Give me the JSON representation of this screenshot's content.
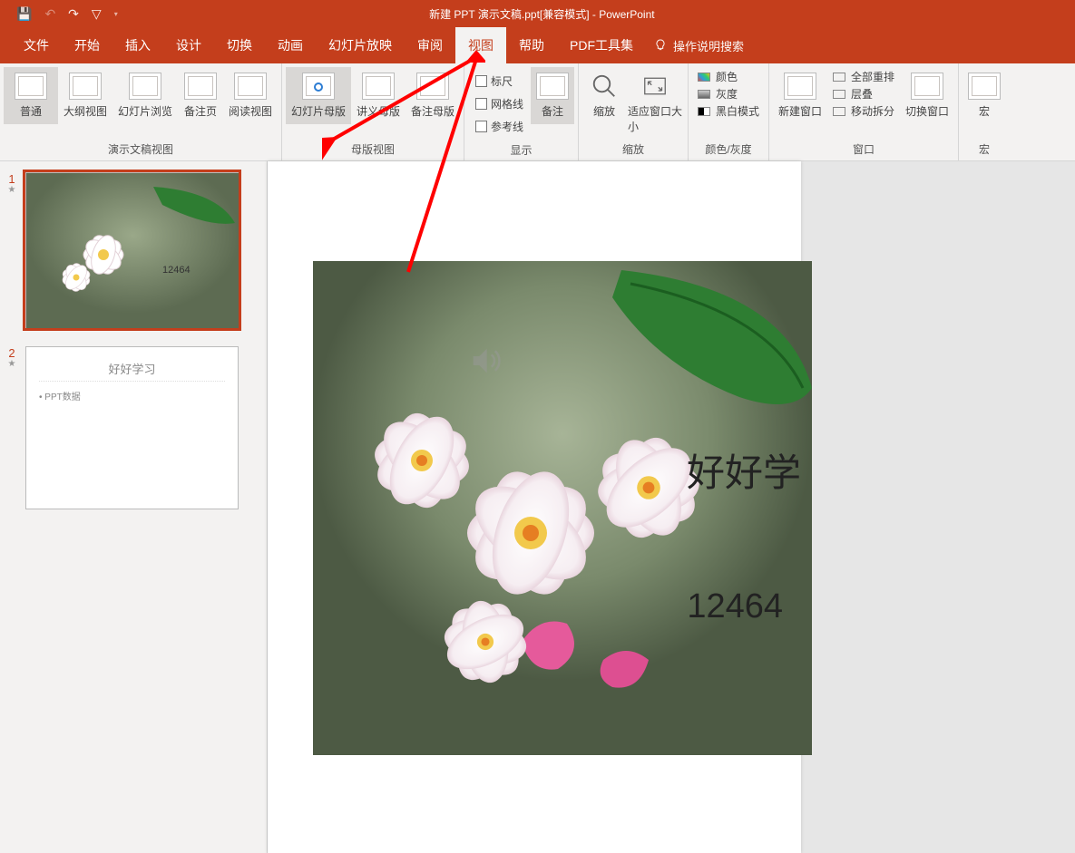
{
  "titlebar": {
    "title": "新建 PPT 演示文稿.ppt[兼容模式] - PowerPoint"
  },
  "menu": {
    "file": "文件",
    "home": "开始",
    "insert": "插入",
    "design": "设计",
    "transitions": "切换",
    "animations": "动画",
    "slideshow": "幻灯片放映",
    "review": "审阅",
    "view": "视图",
    "help": "帮助",
    "pdf": "PDF工具集",
    "tellme": "操作说明搜索"
  },
  "ribbon": {
    "normal": "普通",
    "outline": "大纲视图",
    "browse": "幻灯片浏览",
    "notes_page": "备注页",
    "reading": "阅读视图",
    "slide_master": "幻灯片母版",
    "handout_master": "讲义母版",
    "notes_master": "备注母版",
    "group_presviews": "演示文稿视图",
    "group_masterviews": "母版视图",
    "ruler": "标尺",
    "gridlines": "网格线",
    "guides": "参考线",
    "notes_btn": "备注",
    "group_show": "显示",
    "zoom": "缩放",
    "fit": "适应窗口大小",
    "group_zoom": "缩放",
    "color": "颜色",
    "gray": "灰度",
    "bw": "黑白模式",
    "group_color": "颜色/灰度",
    "newwin": "新建窗口",
    "arrange_all": "全部重排",
    "cascade": "层叠",
    "move_split": "移动拆分",
    "switch_win": "切换窗口",
    "group_window": "窗口",
    "macro": "宏",
    "group_macro": "宏"
  },
  "slides": {
    "s1_num": "1",
    "s2_num": "2",
    "s2_title": "好好学习",
    "s2_bullet": "• PPT数据"
  },
  "canvas": {
    "text": "好好学",
    "number": "12464"
  }
}
